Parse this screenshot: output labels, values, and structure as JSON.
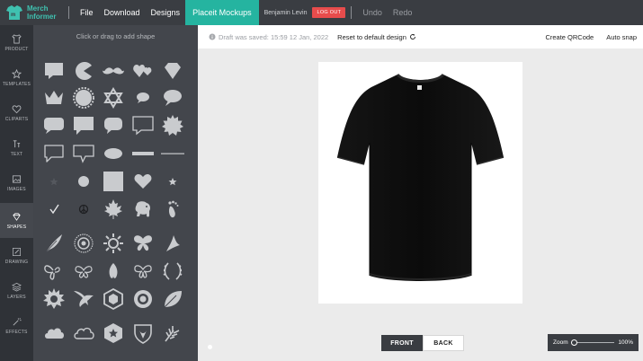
{
  "topbar": {
    "logo_line1": "Merch",
    "logo_line2": "Informer",
    "menu": [
      "File",
      "Download",
      "Designs",
      "Placeit Mockups"
    ],
    "username": "Benjamin Levin",
    "logout_label": "LOG OUT",
    "undo_label": "Undo",
    "redo_label": "Redo"
  },
  "rail": [
    {
      "label": "PRODUCT",
      "icon": "shirt-icon"
    },
    {
      "label": "TEMPLATES",
      "icon": "star-icon"
    },
    {
      "label": "CLIPARTS",
      "icon": "heart-icon"
    },
    {
      "label": "TEXT",
      "icon": "text-icon"
    },
    {
      "label": "IMAGES",
      "icon": "image-icon"
    },
    {
      "label": "SHAPES",
      "icon": "diamond-icon"
    },
    {
      "label": "DRAWING",
      "icon": "pencil-icon"
    },
    {
      "label": "LAYERS",
      "icon": "layers-icon"
    },
    {
      "label": "EFFECTS",
      "icon": "wand-icon"
    }
  ],
  "panel": {
    "hint": "Click or drag to add shape",
    "shapes": [
      "speech-square-icon",
      "pacman-icon",
      "mustache-icon",
      "hearts-icon",
      "diamond-gem-icon",
      "crown-icon",
      "seal-badge-icon",
      "star-of-david-icon",
      "small-bubble-icon",
      "oval-bubble-icon",
      "rounded-bubble-icon",
      "square-bubble-icon",
      "rounded-bubble-2-icon",
      "outline-bubble-icon",
      "burst-badge-icon",
      "outline-speech-icon",
      "outline-speech-2-icon",
      "ellipse-icon",
      "ribbon-bar-icon",
      "line-icon",
      "small-star-icon",
      "circle-icon",
      "square-icon",
      "heart-icon",
      "tiny-star-icon",
      "checkmark-icon",
      "peace-icon",
      "maple-leaf-icon",
      "elephant-icon",
      "footprint-icon",
      "feather-icon",
      "mandala-icon",
      "sun-icon",
      "butterfly-icon",
      "bird-icon",
      "butterfly-outline-icon",
      "butterfly-2-icon",
      "moth-icon",
      "butterfly-3-icon",
      "laurel-icon",
      "gear-sun-icon",
      "eagle-icon",
      "hex-emblem-icon",
      "badge-icon",
      "leaf-icon",
      "cloud-icon",
      "cloud-outline-icon",
      "shield-star-icon",
      "crest-icon",
      "wheat-icon"
    ]
  },
  "canvas_toolbar": {
    "draft_text": "Draft was saved: 15:59 12 Jan, 2022",
    "reset_label": "Reset to default design",
    "create_qr_label": "Create QRCode",
    "auto_snap_label": "Auto snap"
  },
  "canvas": {
    "front_label": "FRONT",
    "back_label": "BACK",
    "zoom_label": "Zoom",
    "zoom_value": "100%",
    "shirt_color": "#0d0d0d"
  }
}
